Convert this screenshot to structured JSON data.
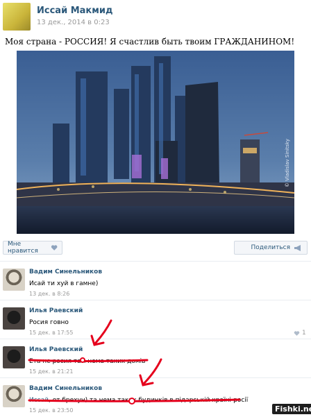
{
  "post": {
    "author": "Иссай Макмид",
    "date": "13 дек., 2014 в 0:23",
    "text": "Моя страна - РОССИЯ! Я счастлив быть твоим ГРАЖДАНИНОМ!",
    "photo_credit": "© Vladislav Sinitsky",
    "like_label": "Мне нравится",
    "share_label": "Поделиться"
  },
  "comments": [
    {
      "name": "Вадим Синельников",
      "text": "Исай ти хуй в гамне)",
      "date": "13 дек. в 8:26"
    },
    {
      "name": "Илья Раевский",
      "text": "Росия говно",
      "date": "15 дек. в 17:55",
      "likes": "1"
    },
    {
      "name": "Илья Раевский",
      "text": "Ета не росия там нема таких домів",
      "date": "15 дек. в 21:21"
    },
    {
      "name": "Вадим Синельников",
      "link": "Иссай",
      "text": ", от брехун) та нема таких будинків в підарській країні-росії",
      "date": "15 дек. в 23:50"
    }
  ],
  "watermark": "Fishki.net",
  "colors": {
    "link": "#2b587a",
    "annotation": "#e5001c",
    "muted": "#999999"
  },
  "icons": [
    "heart-icon",
    "megaphone-icon",
    "heart-small-icon",
    "red-arrow-icon"
  ]
}
